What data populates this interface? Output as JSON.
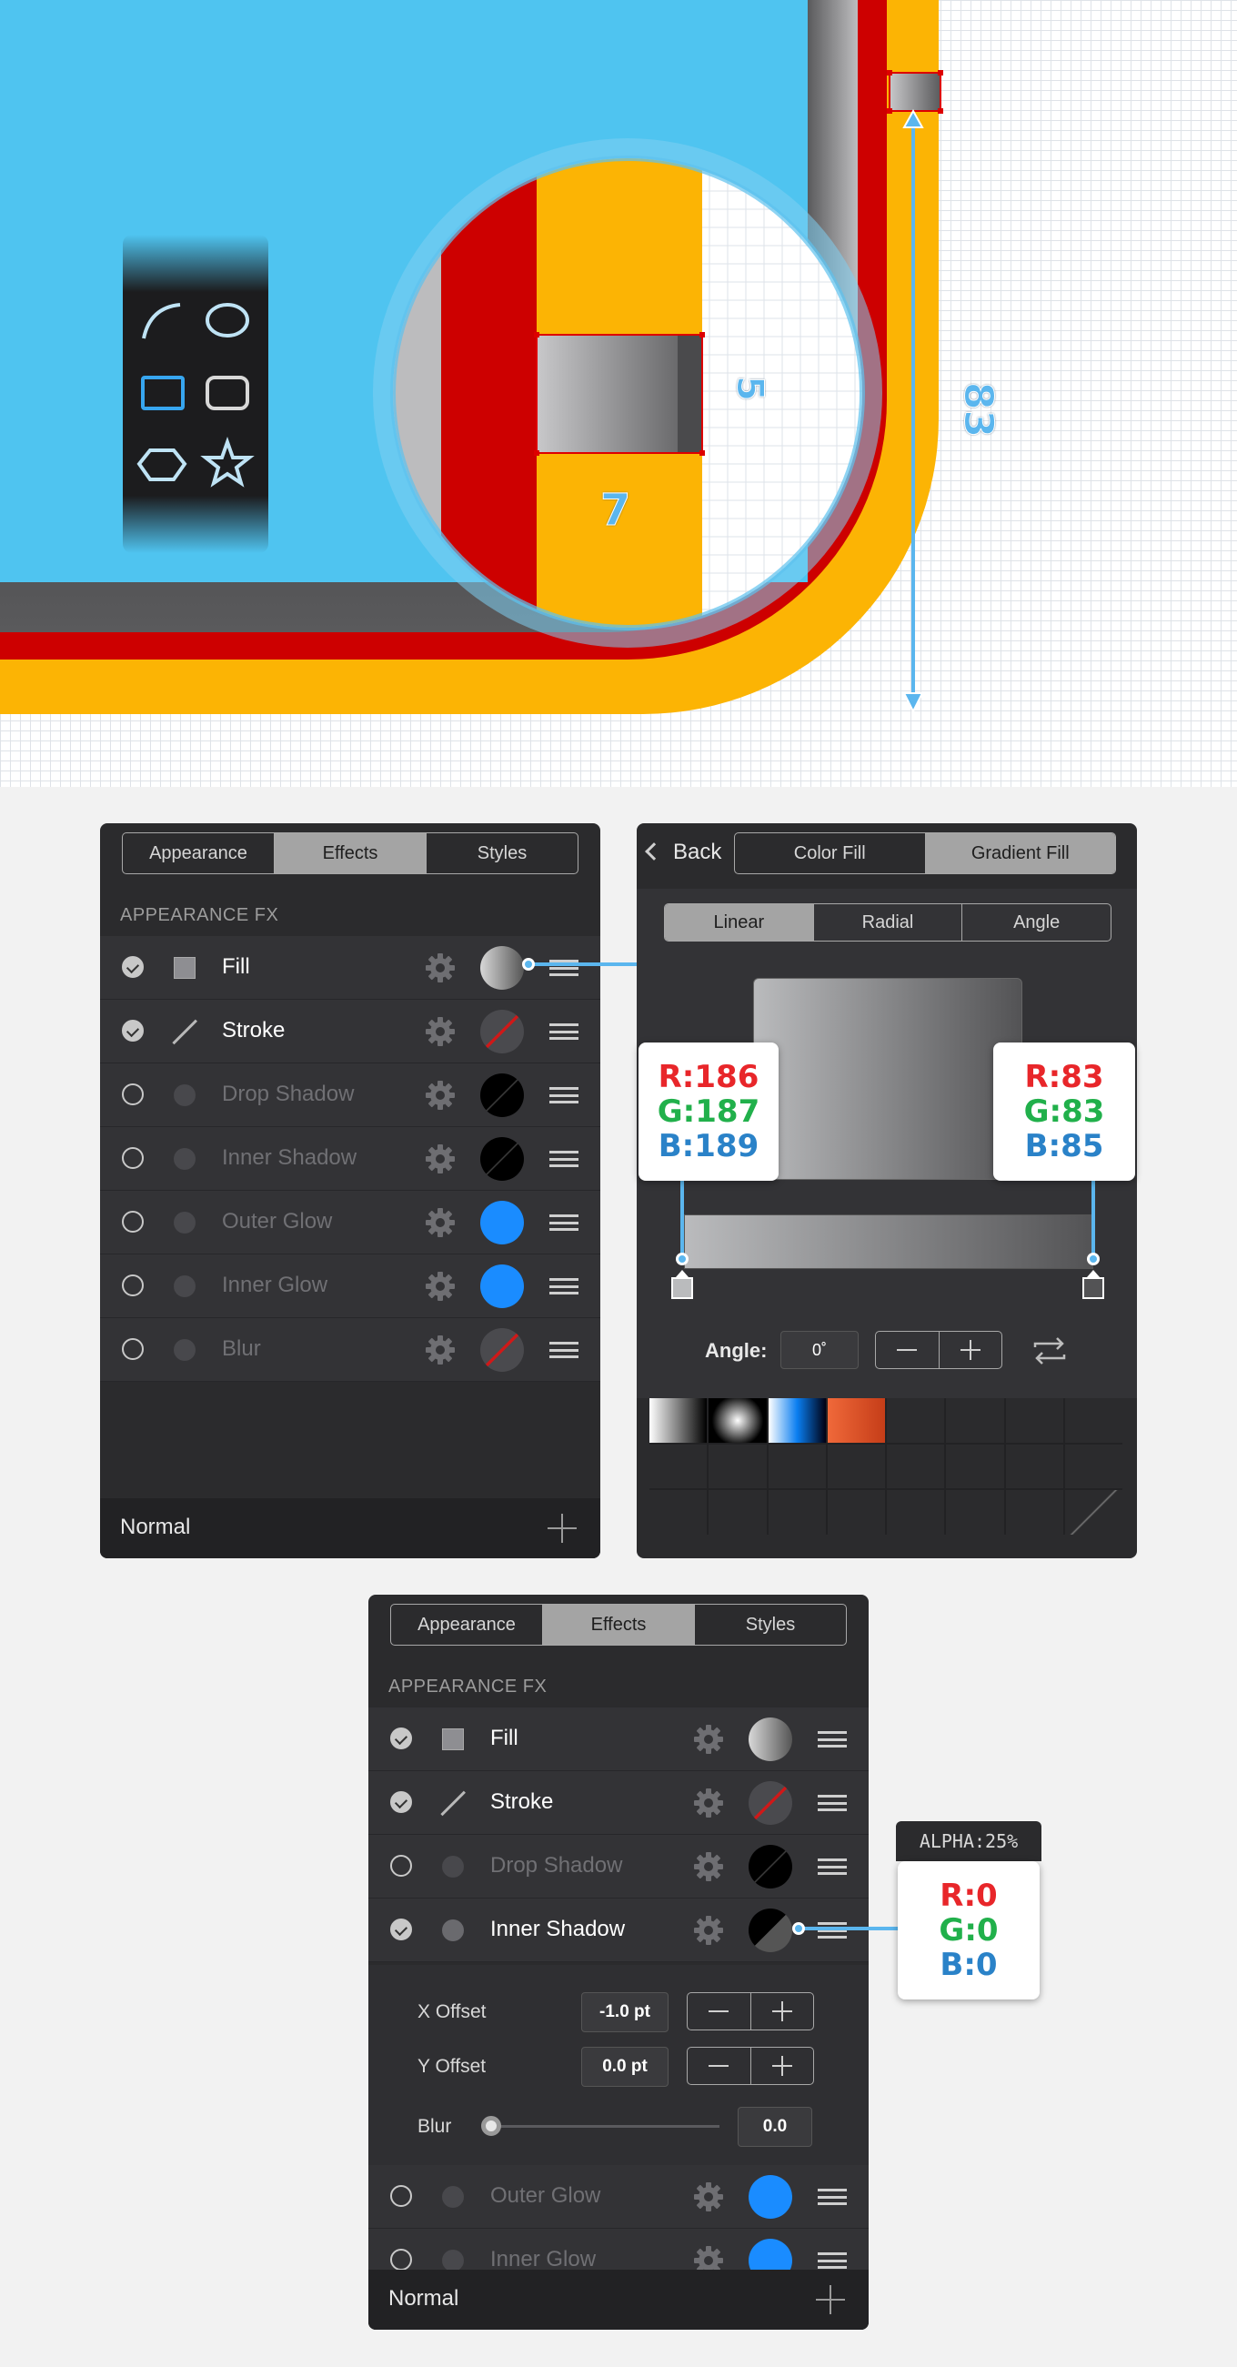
{
  "canvas": {
    "dimensions": {
      "height": "83",
      "stroke": "5",
      "gap": "7"
    }
  },
  "panel1": {
    "tabs": [
      "Appearance",
      "Effects",
      "Styles"
    ],
    "active_tab": "Effects",
    "section_title": "APPEARANCE FX",
    "rows": [
      {
        "label": "Fill",
        "checked": true,
        "icon": "square-icon",
        "swatch": "gradient-gray"
      },
      {
        "label": "Stroke",
        "checked": true,
        "icon": "line-icon",
        "swatch": "none"
      },
      {
        "label": "Drop Shadow",
        "checked": false,
        "icon": "circle-icon",
        "swatch": "black"
      },
      {
        "label": "Inner Shadow",
        "checked": false,
        "icon": "circle-icon",
        "swatch": "black"
      },
      {
        "label": "Outer Glow",
        "checked": false,
        "icon": "circle-icon",
        "swatch": "blue"
      },
      {
        "label": "Inner Glow",
        "checked": false,
        "icon": "circle-icon",
        "swatch": "blue"
      },
      {
        "label": "Blur",
        "checked": false,
        "icon": "circle-icon",
        "swatch": "none"
      }
    ],
    "blend_mode": "Normal"
  },
  "panel2": {
    "back_label": "Back",
    "tabs": [
      "Color Fill",
      "Gradient Fill"
    ],
    "active_tab": "Gradient Fill",
    "type_tabs": [
      "Linear",
      "Radial",
      "Angle"
    ],
    "active_type": "Linear",
    "angle_label": "Angle:",
    "angle_value": "0˚",
    "stop_left": {
      "r": "R:186",
      "g": "G:187",
      "b": "B:189",
      "color": "#babbbd"
    },
    "stop_right": {
      "r": "R:83",
      "g": "G:83",
      "b": "B:85",
      "color": "#535355"
    }
  },
  "panel3": {
    "tabs": [
      "Appearance",
      "Effects",
      "Styles"
    ],
    "active_tab": "Effects",
    "section_title": "APPEARANCE FX",
    "rows": [
      {
        "label": "Fill",
        "checked": true
      },
      {
        "label": "Stroke",
        "checked": true
      },
      {
        "label": "Drop Shadow",
        "checked": false
      },
      {
        "label": "Inner Shadow",
        "checked": true
      }
    ],
    "rows_after": [
      {
        "label": "Outer Glow",
        "checked": false
      },
      {
        "label": "Inner Glow",
        "checked": false
      }
    ],
    "x_offset_label": "X Offset",
    "x_offset_value": "-1.0 pt",
    "y_offset_label": "Y Offset",
    "y_offset_value": "0.0 pt",
    "blur_label": "Blur",
    "blur_value": "0.0",
    "blend_mode": "Normal",
    "shadow_color": {
      "alpha": "ALPHA:25%",
      "r": "R:0",
      "g": "G:0",
      "b": "B:0"
    }
  }
}
